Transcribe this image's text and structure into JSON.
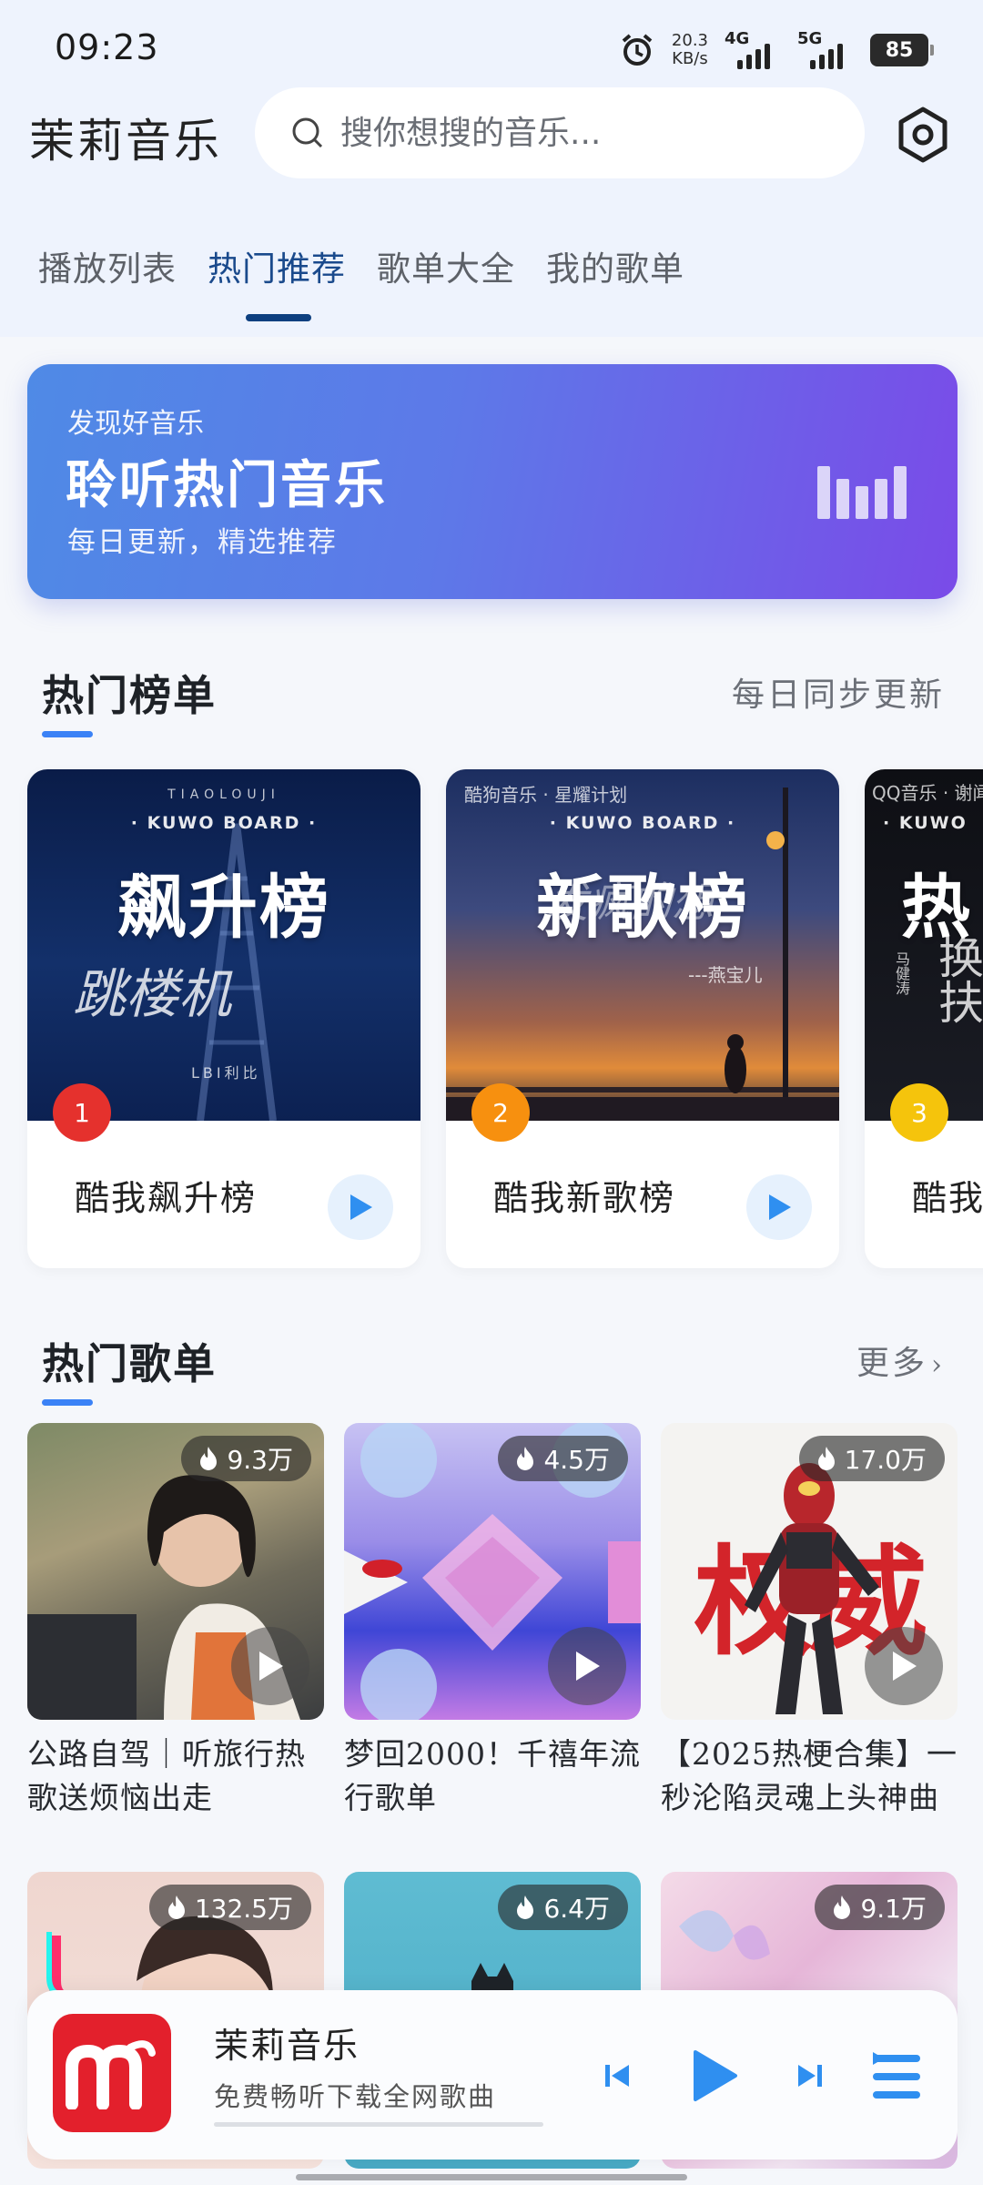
{
  "status_bar": {
    "time": "09:23",
    "net_speed_value": "20.3",
    "net_speed_unit": "KB/s",
    "signal_1": "4G",
    "signal_2": "5G",
    "battery": "85"
  },
  "header": {
    "app_title": "茉莉音乐",
    "search_placeholder": "搜你想搜的音乐...",
    "settings_icon": "hexagon-settings-icon"
  },
  "tabs": [
    {
      "label": "播放列表",
      "active": false
    },
    {
      "label": "热门推荐",
      "active": true
    },
    {
      "label": "歌单大全",
      "active": false
    },
    {
      "label": "我的歌单",
      "active": false
    }
  ],
  "banner": {
    "kicker": "发现好音乐",
    "title": "聆听热门音乐",
    "subtitle": "每日更新，精选推荐"
  },
  "charts_section": {
    "title": "热门榜单",
    "right_text": "每日同步更新",
    "items": [
      {
        "rank": "1",
        "name": "酷我飙升榜",
        "cover_brand": "· KUWO BOARD ·",
        "cover_title": "飙升榜",
        "cover_script": "跳楼机",
        "cover_small": "LBI利比",
        "cover_top": "TIAOLOUJI",
        "badge_color": "#e5312d"
      },
      {
        "rank": "2",
        "name": "酷我新歌榜",
        "cover_brand": "· KUWO BOARD ·",
        "cover_title": "新歌榜",
        "cover_script": "发疯的想",
        "cover_small": "---燕宝儿",
        "cover_top": "酷狗音乐 · 星耀计划",
        "badge_color": "#f7900f"
      },
      {
        "rank": "3",
        "name": "酷我热歌榜",
        "cover_brand": "· KUWO",
        "cover_title": "热",
        "cover_script": "换扶",
        "cover_small": "马健涛",
        "cover_top": "QQ音乐 · 谢闻",
        "badge_color": "#f5c40c"
      }
    ]
  },
  "playlists_section": {
    "title": "热门歌单",
    "more": "更多",
    "items": [
      {
        "count": "9.3万",
        "title": "公路自驾｜听旅行热歌送烦恼出走"
      },
      {
        "count": "4.5万",
        "title": "梦回2000！千禧年流行歌单"
      },
      {
        "count": "17.0万",
        "title": "【2025热梗合集】一秒沦陷灵魂上头神曲",
        "cover_text": "权威"
      },
      {
        "count": "132.5万",
        "title": ""
      },
      {
        "count": "6.4万",
        "title": ""
      },
      {
        "count": "9.1万",
        "title": ""
      }
    ]
  },
  "player": {
    "title": "茉莉音乐",
    "subtitle": "免费畅听下载全网歌曲",
    "logo_letter": "m",
    "progress": 0,
    "accent": "#2f8ff0"
  }
}
